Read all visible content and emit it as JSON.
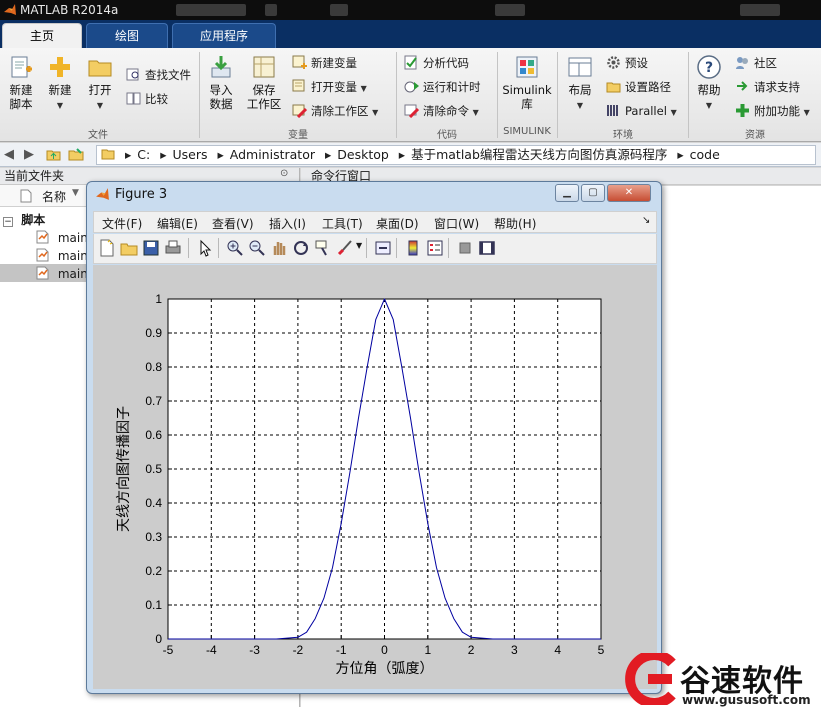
{
  "app": {
    "title": "MATLAB R2014a"
  },
  "tabs": [
    {
      "label": "主页",
      "active": true
    },
    {
      "label": "绘图",
      "active": false
    },
    {
      "label": "应用程序",
      "active": false
    }
  ],
  "ribbon": {
    "file": {
      "section": "文件",
      "new_script": [
        "新建",
        "脚本"
      ],
      "new": "新建",
      "open": "打开",
      "find_files": "查找文件",
      "compare": "比较"
    },
    "variable": {
      "section": "变量",
      "import_data": [
        "导入",
        "数据"
      ],
      "save_workspace": [
        "保存",
        "工作区"
      ],
      "new_variable": "新建变量",
      "open_variable": "打开变量",
      "clear_workspace": "清除工作区"
    },
    "code": {
      "section": "代码",
      "analyze": "分析代码",
      "run_time": "运行和计时",
      "clear_commands": "清除命令"
    },
    "simulink": {
      "section": "SIMULINK",
      "library": [
        "Simulink",
        "库"
      ]
    },
    "environment": {
      "section": "环境",
      "layout": "布局",
      "preferences": "预设",
      "set_path": "设置路径",
      "parallel": "Parallel"
    },
    "resources": {
      "section": "资源",
      "help": "帮助",
      "community": "社区",
      "request_support": "请求支持",
      "add_ons": "附加功能"
    }
  },
  "address": {
    "path": [
      "C:",
      "Users",
      "Administrator",
      "Desktop",
      "基于matlab编程雷达天线方向图仿真源码程序",
      "code"
    ]
  },
  "current_folder": {
    "title": "当前文件夹",
    "column_name": "名称",
    "group": "脚本",
    "files": [
      "main_",
      "main_",
      "main_"
    ]
  },
  "command_window": {
    "title": "命令行窗口"
  },
  "figure": {
    "title": "Figure 3",
    "menus": [
      "文件(F)",
      "编辑(E)",
      "查看(V)",
      "插入(I)",
      "工具(T)",
      "桌面(D)",
      "窗口(W)",
      "帮助(H)"
    ],
    "toolbar_icons": [
      "new-figure-icon",
      "open-icon",
      "save-icon",
      "print-icon",
      "pointer-icon",
      "zoom-in-icon",
      "zoom-out-icon",
      "pan-hand-icon",
      "rotate-3d-icon",
      "data-cursor-icon",
      "brush-icon",
      "link-icon",
      "colorbar-icon",
      "legend-icon",
      "hide-plot-tools-icon",
      "show-plot-tools-icon"
    ]
  },
  "chart_data": {
    "type": "line",
    "title": "",
    "xlabel": "方位角（弧度）",
    "ylabel": "天线方向图传播因子",
    "xlim": [
      -5,
      5
    ],
    "ylim": [
      0,
      1
    ],
    "xticks": [
      "-5",
      "-4",
      "-3",
      "-2",
      "-1",
      "0",
      "1",
      "2",
      "3",
      "4",
      "5"
    ],
    "yticks": [
      "0",
      "0.1",
      "0.2",
      "0.3",
      "0.4",
      "0.5",
      "0.6",
      "0.7",
      "0.8",
      "0.9",
      "1"
    ],
    "grid": true,
    "line_color": "#0000a0",
    "series": [
      {
        "x": [
          -5,
          -3,
          -2.5,
          -2,
          -1.8,
          -1.6,
          -1.4,
          -1.2,
          -1.0,
          -0.8,
          -0.6,
          -0.4,
          -0.2,
          0,
          0.2,
          0.4,
          0.6,
          0.8,
          1.0,
          1.2,
          1.4,
          1.6,
          1.8,
          2.0,
          2.5,
          3,
          5
        ],
        "y": [
          0,
          0,
          0,
          0.005,
          0.02,
          0.06,
          0.12,
          0.21,
          0.34,
          0.49,
          0.65,
          0.8,
          0.94,
          1.0,
          0.94,
          0.8,
          0.65,
          0.49,
          0.34,
          0.21,
          0.12,
          0.06,
          0.02,
          0.005,
          0,
          0,
          0
        ]
      }
    ]
  },
  "watermark": {
    "brand": "谷速软件",
    "url": "www.gususoft.com"
  }
}
